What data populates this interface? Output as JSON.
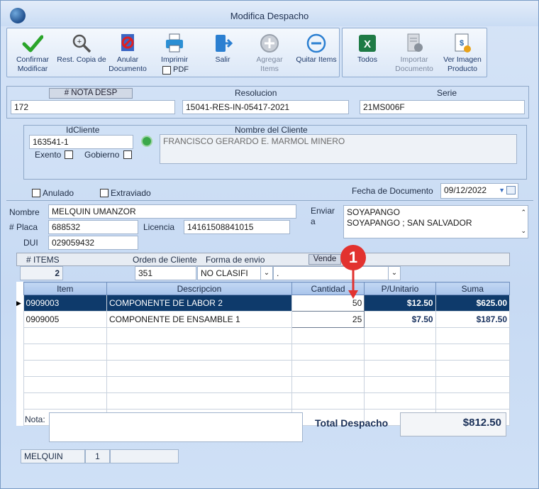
{
  "window": {
    "title": "Modifica Despacho"
  },
  "toolbar": {
    "confirm": "Confirmar Modificar",
    "restore": "Rest. Copia de",
    "void": "Anular Documento",
    "print": "Imprimir",
    "pdf": "PDF",
    "exit": "Salir",
    "add_items": "Agregar Items",
    "remove_items": "Quitar Items",
    "all": "Todos",
    "import": "Importar Documento",
    "image": "Ver Imagen Producto"
  },
  "header": {
    "nota_label": "# NOTA DESP",
    "nota_value": "172",
    "resolucion_label": "Resolucion",
    "resolucion_value": "15041-RES-IN-05417-2021",
    "serie_label": "Serie",
    "serie_value": "21MS006F"
  },
  "client": {
    "id_label": "IdCliente",
    "id_value": "163541-1",
    "name_label": "Nombre del Cliente",
    "name_value": "FRANCISCO GERARDO E. MARMOL MINERO",
    "exento_label": "Exento",
    "gobierno_label": "Gobierno"
  },
  "flags": {
    "anulado": "Anulado",
    "extraviado": "Extraviado"
  },
  "fecha": {
    "label": "Fecha de Documento",
    "value": "09/12/2022"
  },
  "person": {
    "nombre_label": "Nombre",
    "nombre_value": "MELQUIN UMANZOR",
    "placa_label": "# Placa",
    "placa_value": "688532",
    "licencia_label": "Licencia",
    "licencia_value": "14161508841015",
    "dui_label": "DUI",
    "dui_value": "029059432",
    "enviar_label_1": "Enviar",
    "enviar_label_2": "a",
    "enviar_line1": "SOYAPANGO",
    "enviar_line2": "SOYAPANGO ; SAN SALVADOR"
  },
  "info": {
    "items_label": "# ITEMS",
    "items_value": "2",
    "orden_label": "Orden de Cliente",
    "orden_value": "351",
    "forma_label": "Forma de envio",
    "forma_value": "NO CLASIFI",
    "vende_label": "Vende",
    "vende_value": "."
  },
  "grid": {
    "headers": [
      "Item",
      "Descripcion",
      "Cantidad",
      "P/Unitario",
      "Suma"
    ],
    "rows": [
      {
        "item": "0909003",
        "desc": "COMPONENTE DE LABOR 2",
        "qty": "50",
        "unit": "$12.50",
        "sum": "$625.00"
      },
      {
        "item": "0909005",
        "desc": "COMPONENTE DE ENSAMBLE 1",
        "qty": "25",
        "unit": "$7.50",
        "sum": "$187.50"
      }
    ]
  },
  "footer": {
    "nota_label": "Nota:",
    "total_label": "Total Despacho",
    "total_value": "$812.50",
    "status_user": "MELQUIN",
    "status_num": "1"
  },
  "callout": {
    "number": "1"
  },
  "colors": {
    "accent": "#0e3a6b",
    "callout": "#e2322f"
  }
}
